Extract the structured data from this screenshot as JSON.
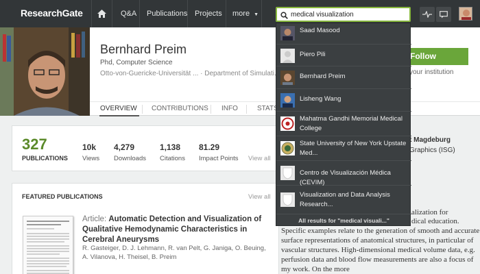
{
  "nav": {
    "logo": "ResearchGate",
    "items": [
      "Q&A",
      "Publications",
      "Projects",
      "more"
    ],
    "search_value": "medical visualization"
  },
  "profile": {
    "name": "Bernhard Preim",
    "degree": "Phd, Computer Science",
    "affiliation": "Otto-von-Guericke-Universität ... · Department of Simulati...",
    "follow": "Follow",
    "your_institution": "your institution",
    "tabs": [
      "OVERVIEW",
      "CONTRIBUTIONS",
      "INFO",
      "STATS"
    ]
  },
  "stats": {
    "publications_count": "327",
    "publications_label": "PUBLICATIONS",
    "items": [
      {
        "value": "10k",
        "label": "Views"
      },
      {
        "value": "4,279",
        "label": "Downloads"
      },
      {
        "value": "1,138",
        "label": "Citations"
      },
      {
        "value": "81.29",
        "label": "Impact Points"
      }
    ],
    "view_all": "View all"
  },
  "featured": {
    "title": "FEATURED PUBLICATIONS",
    "view_all": "View all",
    "article_prefix": "Article:",
    "article_title": "Automatic Detection and Visualization of Qualitative Hemodynamic Characteristics in Cerebral Aneurysms",
    "authors": "R. Gasteiger, D. J. Lehmann, R. van Pelt, G. Janiga, O. Beuing, A. Vilanova, H. Theisel, B. Preim"
  },
  "institution": {
    "name": "t Magdeburg",
    "dept": "Graphics (ISG)"
  },
  "bio": {
    "top_lines": [
      "alization for",
      "dical education."
    ],
    "text": "Specific examples relate to the generation of smooth and accurate surface representations of anatomical structures, in particular of vascular structures. High-dimensional medical volume data, e.g. perfusion data and blood flow measurements are also a focus of my work. On the more"
  },
  "dropdown": {
    "results": [
      {
        "label": "Saad Masood"
      },
      {
        "label": "Piero Pili"
      },
      {
        "label": "Bernhard Preim"
      },
      {
        "label": "Lisheng Wang"
      },
      {
        "label": "Mahatma Gandhi Memorial Medical College"
      },
      {
        "label": "State University of New York Upstate Med..."
      },
      {
        "label": "Centro de Visualización Médica (CEVIM)"
      },
      {
        "label": "Visualization and Data Analysis Research..."
      }
    ],
    "all_results": "All results for \"medical visuali...\""
  }
}
